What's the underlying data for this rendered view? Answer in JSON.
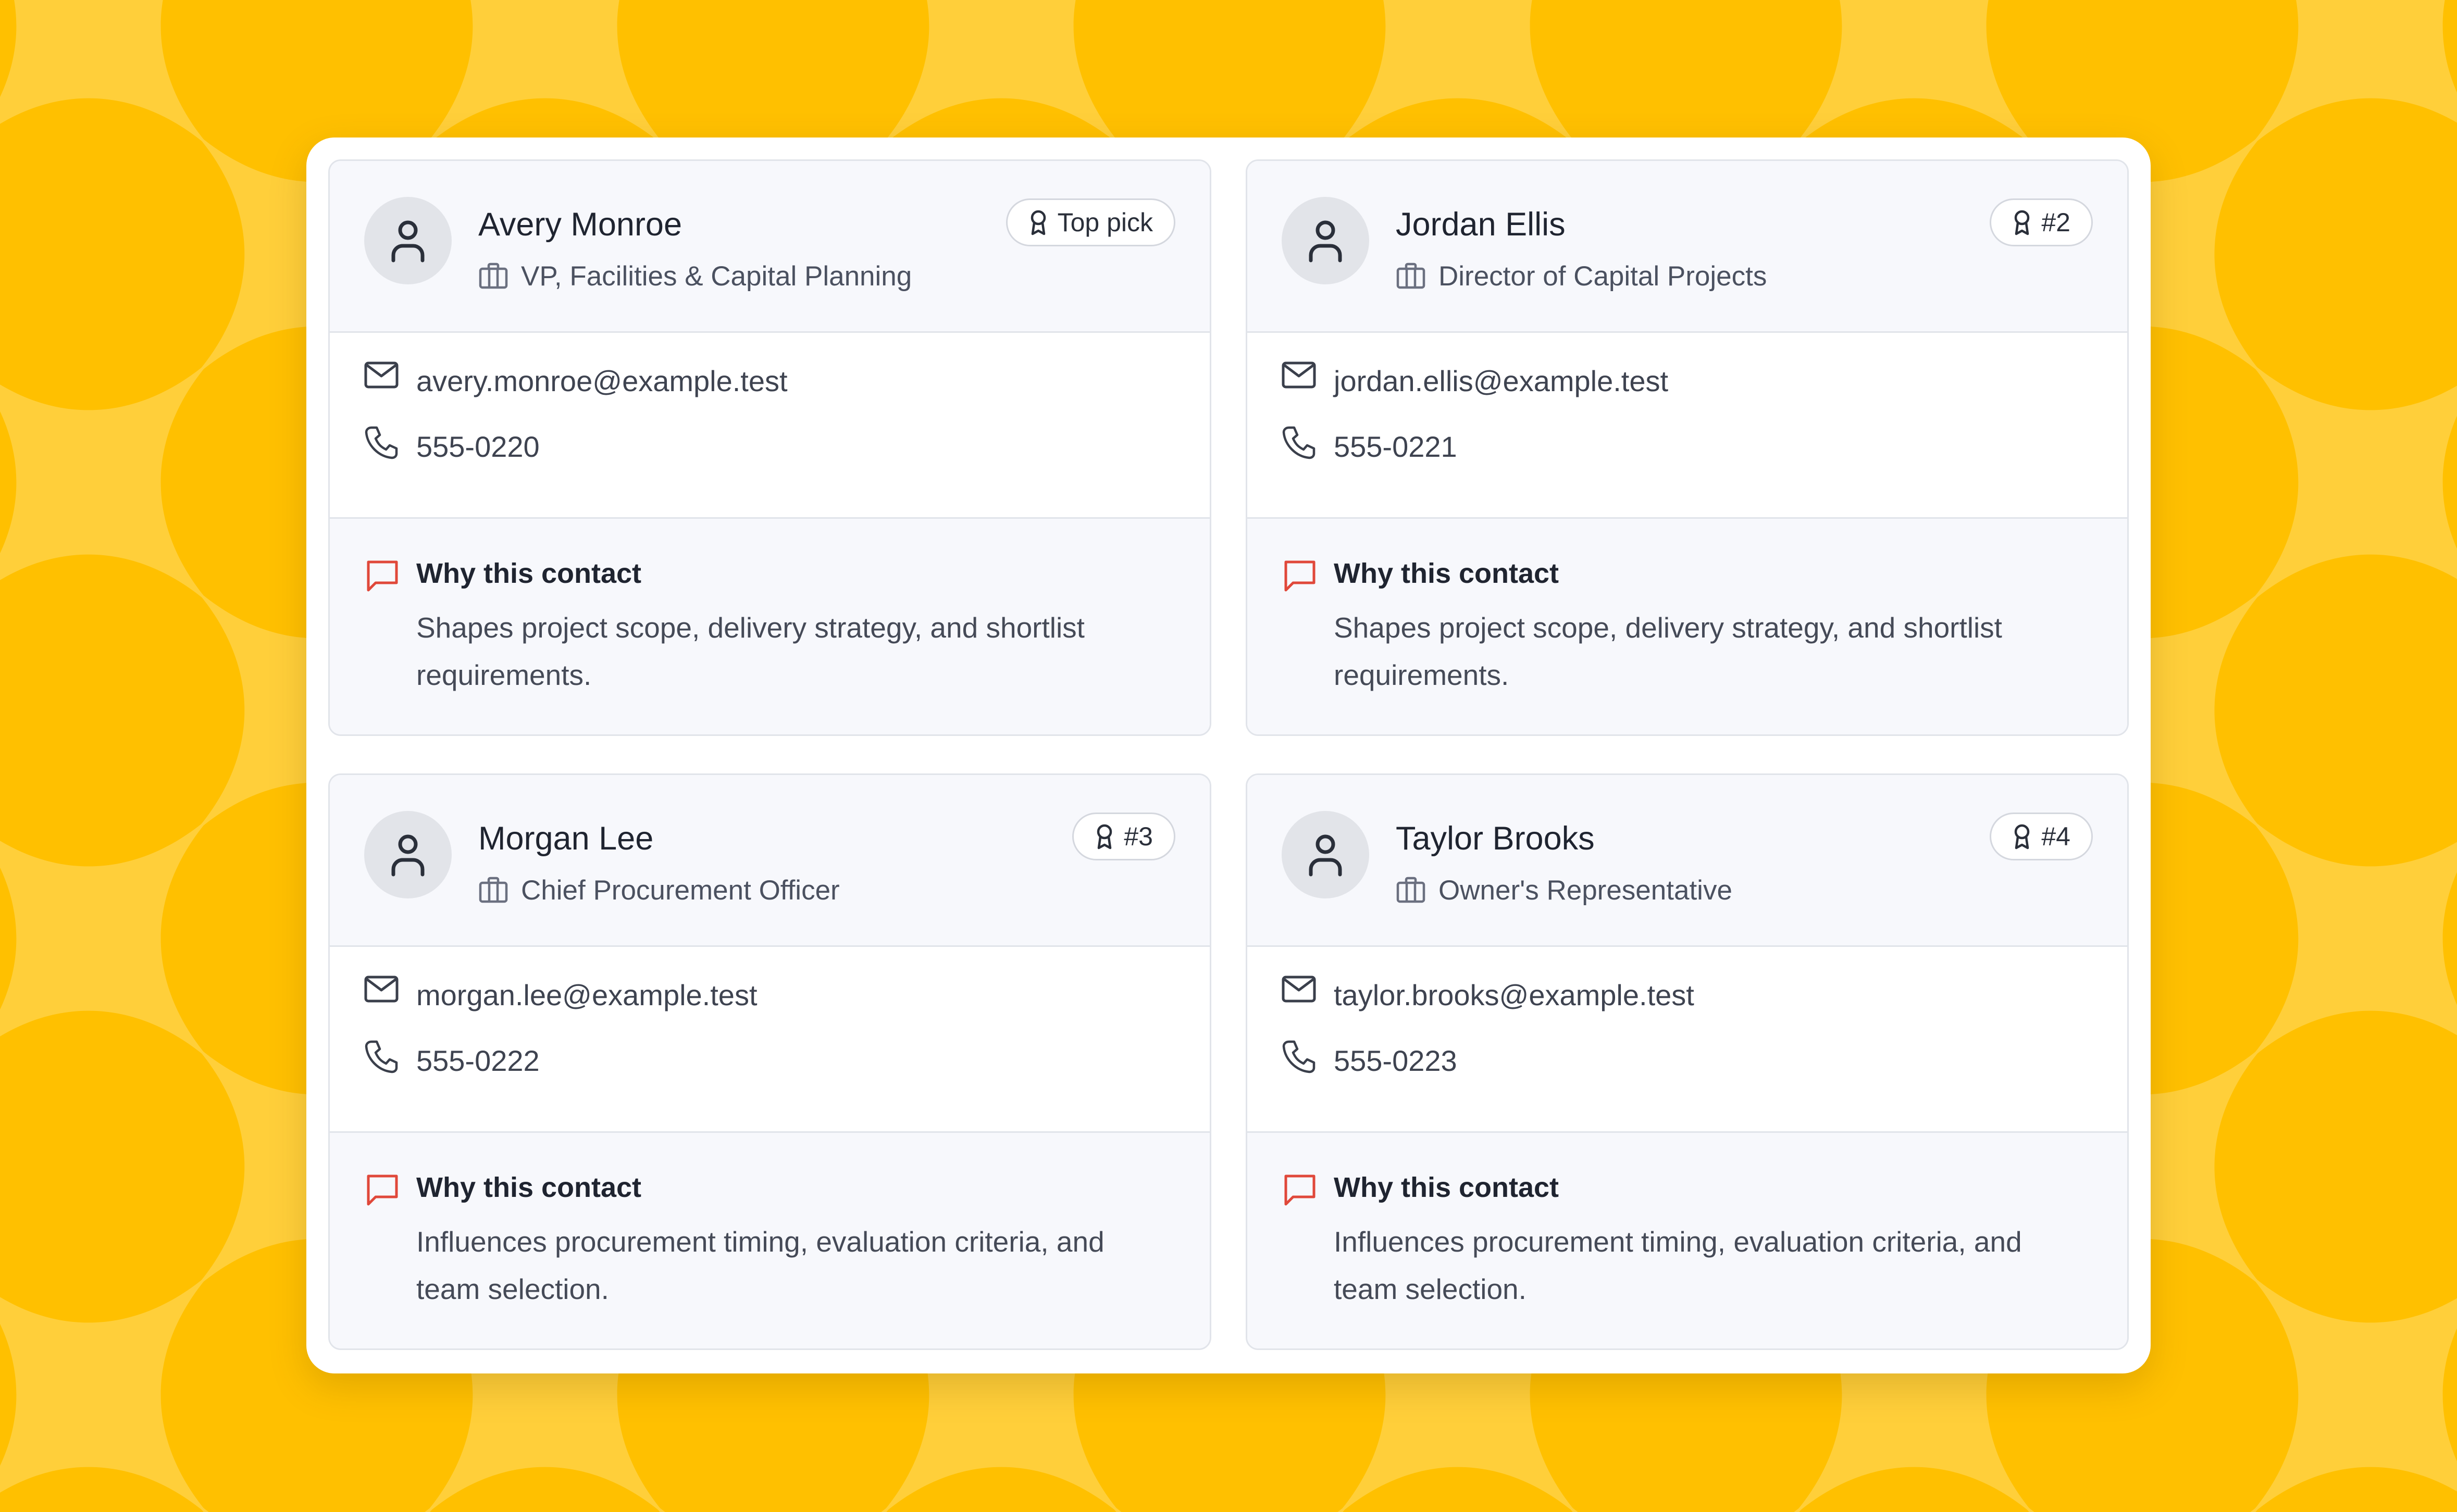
{
  "colors": {
    "background": "#FFC000",
    "pattern": "#FFCF3A",
    "panel": "#FFFFFF",
    "card_header": "#F7F8FC",
    "accent_red": "#E0483A"
  },
  "why_heading": "Why this contact",
  "contacts": [
    {
      "name": "Avery Monroe",
      "title": "VP, Facilities & Capital Planning",
      "badge": "Top pick",
      "email": "avery.monroe@example.test",
      "phone": "555-0220",
      "why": "Shapes project scope, delivery strategy, and shortlist requirements."
    },
    {
      "name": "Jordan Ellis",
      "title": "Director of Capital Projects",
      "badge": "#2",
      "email": "jordan.ellis@example.test",
      "phone": "555-0221",
      "why": "Shapes project scope, delivery strategy, and shortlist requirements."
    },
    {
      "name": "Morgan Lee",
      "title": "Chief Procurement Officer",
      "badge": "#3",
      "email": "morgan.lee@example.test",
      "phone": "555-0222",
      "why": "Influences procurement timing, evaluation criteria, and team selection."
    },
    {
      "name": "Taylor Brooks",
      "title": "Owner's Representative",
      "badge": "#4",
      "email": "taylor.brooks@example.test",
      "phone": "555-0223",
      "why": "Influences procurement timing, evaluation criteria, and team selection."
    }
  ]
}
